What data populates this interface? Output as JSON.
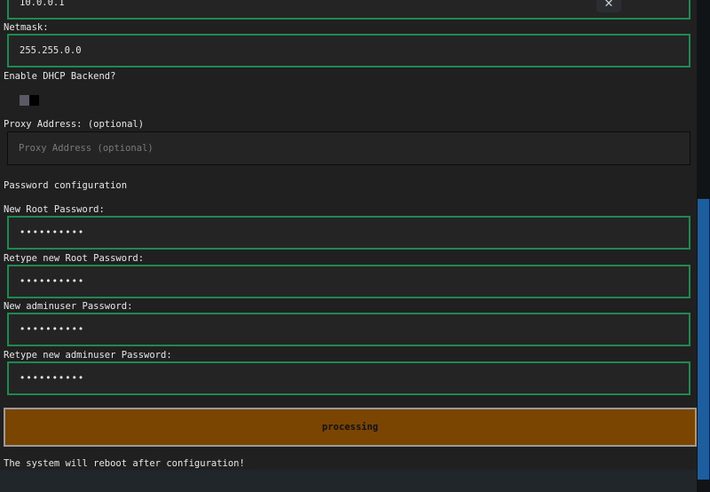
{
  "form": {
    "ip_value": "10.0.0.1",
    "netmask_label": "Netmask:",
    "netmask_value": "255.255.0.0",
    "dhcp_label": "Enable DHCP Backend?",
    "proxy_label": "Proxy Address: (optional)",
    "proxy_placeholder": "Proxy Address (optional)",
    "password_section_title": "Password configuration",
    "root_pw_label": "New Root Password:",
    "root_pw_value": "••••••••••",
    "root_pw_retype_label": "Retype new Root Password:",
    "root_pw_retype_value": "••••••••••",
    "admin_pw_label": "New adminuser Password:",
    "admin_pw_value": "••••••••••",
    "admin_pw_retype_label": "Retype new adminuser Password:",
    "admin_pw_retype_value": "••••••••••",
    "submit_label": "processing",
    "reboot_notice": "The system will reboot after configuration!"
  },
  "icons": {
    "clear": "close-icon"
  },
  "colors": {
    "field_border": "#1e8a52",
    "submit_bg": "#7a4500",
    "scroll_thumb": "#1d5f9e"
  }
}
